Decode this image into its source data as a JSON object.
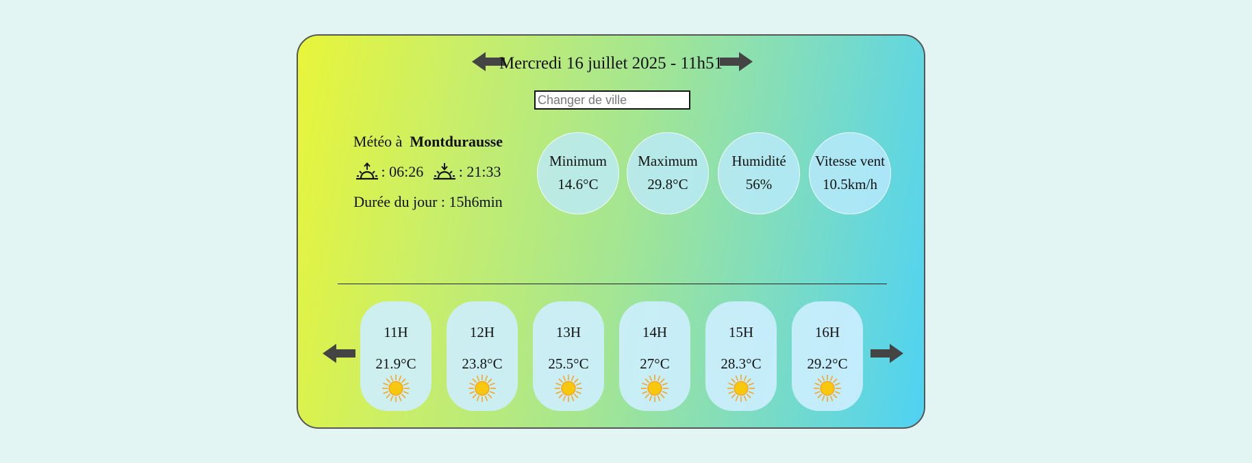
{
  "header": {
    "date_label": "Mercredi 16 juillet 2025 - 11h51",
    "prev_icon": "arrow-left-icon",
    "next_icon": "arrow-right-icon"
  },
  "search": {
    "placeholder": "Changer de ville",
    "value": ""
  },
  "location": {
    "prefix": "Météo à",
    "city": "Montdurausse",
    "sunrise": ": 06:26",
    "sunset": ": 21:33",
    "day_length": "Durée du jour : 15h6min",
    "sunrise_icon": "sunrise-icon",
    "sunset_icon": "sunset-icon"
  },
  "stats": [
    {
      "label": "Minimum",
      "value": "14.6°C"
    },
    {
      "label": "Maximum",
      "value": "29.8°C"
    },
    {
      "label": "Humidité",
      "value": "56%"
    },
    {
      "label": "Vitesse vent",
      "value": "10.5km/h"
    }
  ],
  "forecast": [
    {
      "hour": "11H",
      "temp": "21.9°C",
      "icon": "sun-icon"
    },
    {
      "hour": "12H",
      "temp": "23.8°C",
      "icon": "sun-icon"
    },
    {
      "hour": "13H",
      "temp": "25.5°C",
      "icon": "sun-icon"
    },
    {
      "hour": "14H",
      "temp": "27°C",
      "icon": "sun-icon"
    },
    {
      "hour": "15H",
      "temp": "28.3°C",
      "icon": "sun-icon"
    },
    {
      "hour": "16H",
      "temp": "29.2°C",
      "icon": "sun-icon"
    }
  ],
  "colors": {
    "background": "#e2f5f2",
    "gradient_start": "#e8f53a",
    "gradient_end": "#4fd2f3",
    "arrow": "#444444",
    "sun": "#f9c80e",
    "sun_rays": "#f5a623"
  }
}
